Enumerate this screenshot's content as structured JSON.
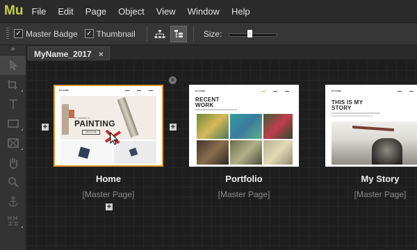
{
  "app": {
    "logo": "Mu"
  },
  "menu": [
    "File",
    "Edit",
    "Page",
    "Object",
    "View",
    "Window",
    "Help"
  ],
  "toolbar": {
    "master_badge_label": "Master Badge",
    "master_badge_checked": true,
    "thumbnail_label": "Thumbnail",
    "thumbnail_checked": true,
    "size_label": "Size:",
    "size_value": 0.45
  },
  "tabs": [
    {
      "label": "MyName_2017",
      "close": "×"
    }
  ],
  "pages": [
    {
      "name": "Home",
      "master": "[Master Page]",
      "selected": true,
      "preview": {
        "site": "MY NAME",
        "small": "MY JOURNEY IS",
        "headline": "PAINTING",
        "button": "ABOUT ME"
      }
    },
    {
      "name": "Portfolio",
      "master": "[Master Page]",
      "selected": false,
      "preview": {
        "site": "MY NAME",
        "headline1": "RECENT",
        "headline2": "WORK"
      }
    },
    {
      "name": "My Story",
      "master": "[Master Page]",
      "selected": false,
      "preview": {
        "site": "MY NAME",
        "headline1": "THIS IS MY",
        "headline2": "STORY"
      }
    }
  ],
  "icons": {
    "tools": [
      "selection-arrow-icon",
      "crop-icon",
      "text-icon",
      "rectangle-icon",
      "image-frame-icon",
      "hand-icon",
      "zoom-icon",
      "anchor-icon",
      "spacing-icon"
    ],
    "plus": "+",
    "close": "×"
  }
}
